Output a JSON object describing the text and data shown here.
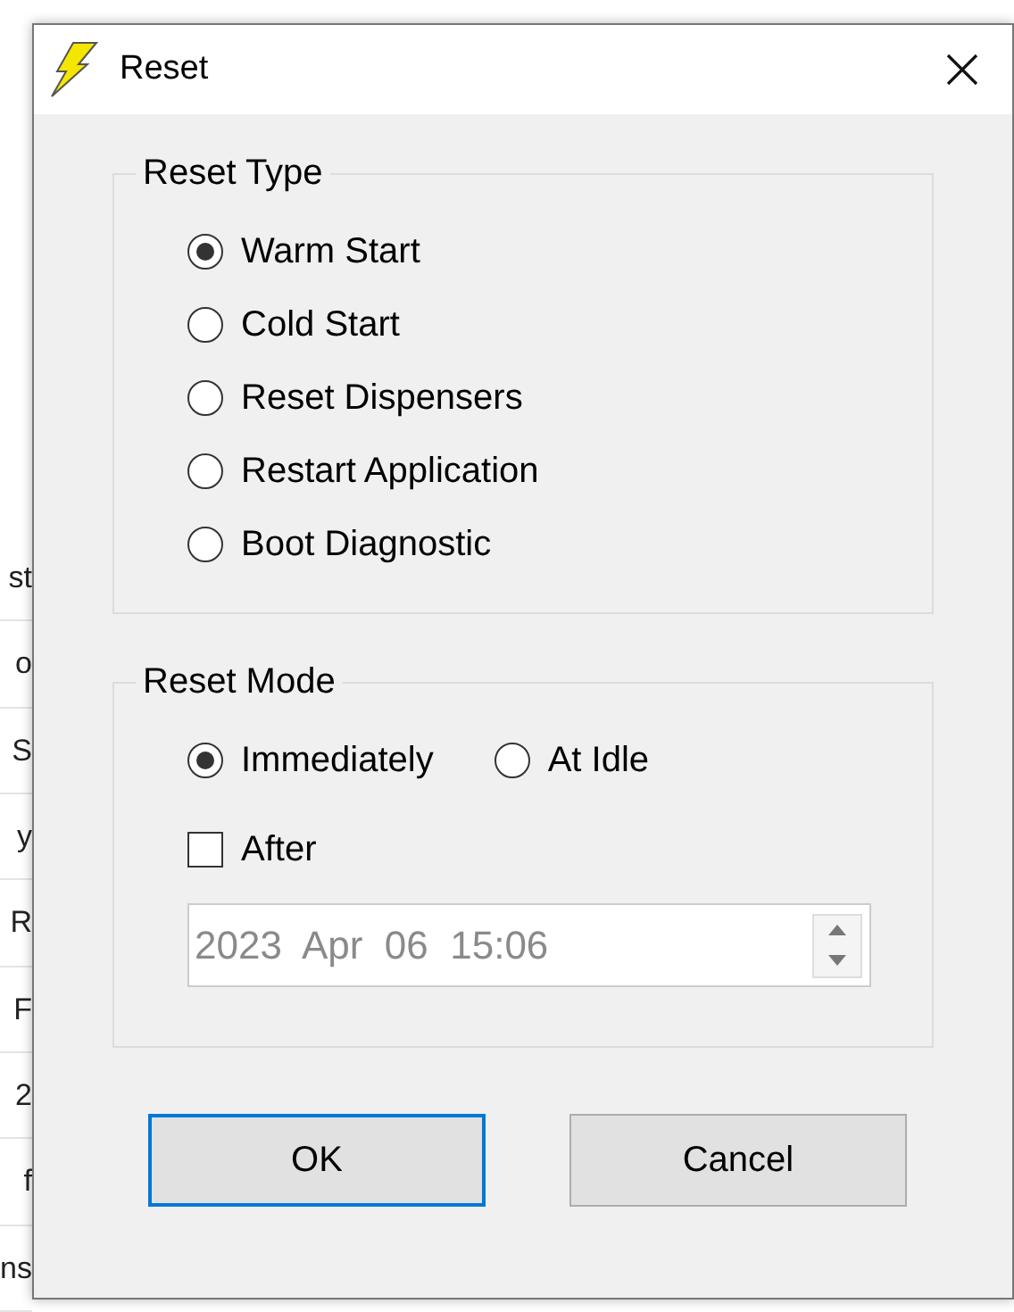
{
  "background_window": {
    "row_fragments": [
      "st",
      "o",
      "S",
      "y",
      "R",
      "F",
      "2",
      "f",
      "ns"
    ]
  },
  "window": {
    "title": "Reset"
  },
  "reset_type": {
    "label": "Reset Type",
    "options": [
      {
        "label": "Warm Start",
        "selected": true
      },
      {
        "label": "Cold Start",
        "selected": false
      },
      {
        "label": "Reset Dispensers",
        "selected": false
      },
      {
        "label": "Restart Application",
        "selected": false
      },
      {
        "label": "Boot Diagnostic",
        "selected": false
      }
    ]
  },
  "reset_mode": {
    "label": "Reset Mode",
    "options": [
      {
        "label": "Immediately",
        "selected": true
      },
      {
        "label": "At Idle",
        "selected": false
      }
    ],
    "after": {
      "label": "After",
      "checked": false
    },
    "datetime": {
      "value": "2023  Apr  06  15:06",
      "disabled": true
    }
  },
  "buttons": [
    {
      "label": "OK",
      "default": true
    },
    {
      "label": "Cancel",
      "default": false
    }
  ]
}
